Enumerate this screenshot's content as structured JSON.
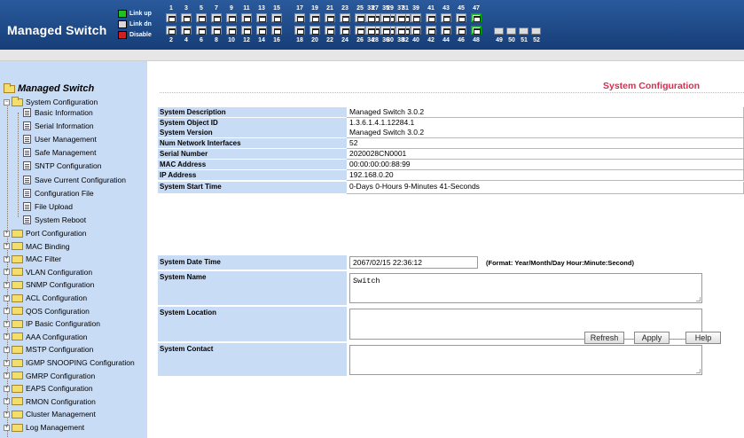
{
  "header": {
    "title": "Managed Switch",
    "legend": [
      {
        "label": "Link up",
        "color": "#20c020"
      },
      {
        "label": "Link dn",
        "color": "#d8d8d8"
      },
      {
        "label": "Disable",
        "color": "#d02020"
      }
    ],
    "port_top_numbers": [
      "1",
      "3",
      "5",
      "7",
      "9",
      "11",
      "13",
      "15",
      "17",
      "19",
      "21",
      "23",
      "25",
      "27",
      "29",
      "31",
      "33",
      "35",
      "37",
      "39",
      "41",
      "43",
      "45",
      "47"
    ],
    "port_bottom_numbers": [
      "2",
      "4",
      "6",
      "8",
      "10",
      "12",
      "14",
      "16",
      "18",
      "20",
      "22",
      "24",
      "26",
      "28",
      "30",
      "32",
      "34",
      "36",
      "38",
      "40",
      "42",
      "44",
      "46",
      "48"
    ],
    "sfp_numbers": [
      "49",
      "50",
      "51",
      "52"
    ],
    "ports_up": [
      "47",
      "48"
    ]
  },
  "sidebar": {
    "root": "Managed Switch",
    "open_group": "System Configuration",
    "children": [
      "Basic Information",
      "Serial Information",
      "User Management",
      "Safe Management",
      "SNTP Configuration",
      "Save Current Configuration",
      "Configuration File",
      "File Upload",
      "System Reboot"
    ],
    "groups": [
      "Port Configuration",
      "MAC Binding",
      "MAC Filter",
      "VLAN Configuration",
      "SNMP Configuration",
      "ACL Configuration",
      "QOS Configuration",
      "IP Basic Configuration",
      "AAA Configuration",
      "MSTP Configuration",
      "IGMP SNOOPING Configuration",
      "GMRP Configuration",
      "EAPS Configuration",
      "RMON Configuration",
      "Cluster Management",
      "Log Management"
    ]
  },
  "main": {
    "title": "System Configuration",
    "rows": [
      {
        "label": "System Description",
        "value": "Managed Switch 3.0.2"
      },
      {
        "label": "System Object ID",
        "value": "1.3.6.1.4.1.12284.1"
      },
      {
        "label": "System Version",
        "value": "Managed Switch 3.0.2"
      },
      {
        "label": "Num Network Interfaces",
        "value": "52"
      },
      {
        "label": "Serial Number",
        "value": "2020028CN0001"
      },
      {
        "label": "MAC Address",
        "value": "00:00:00:00:88:99"
      },
      {
        "label": "IP Address",
        "value": "192.168.0.20"
      },
      {
        "label": "System Start Time",
        "value": "0-Days 0-Hours 9-Minutes 41-Seconds"
      }
    ],
    "date_label": "System Date Time",
    "date_value": "2067/02/15 22:36:12",
    "date_format": "(Format: Year/Month/Day Hour:Minute:Second)",
    "name_label": "System Name",
    "name_value": "Switch",
    "location_label": "System Location",
    "location_value": "",
    "contact_label": "System Contact",
    "contact_value": "",
    "buttons": {
      "refresh": "Refresh",
      "apply": "Apply",
      "help": "Help"
    }
  }
}
